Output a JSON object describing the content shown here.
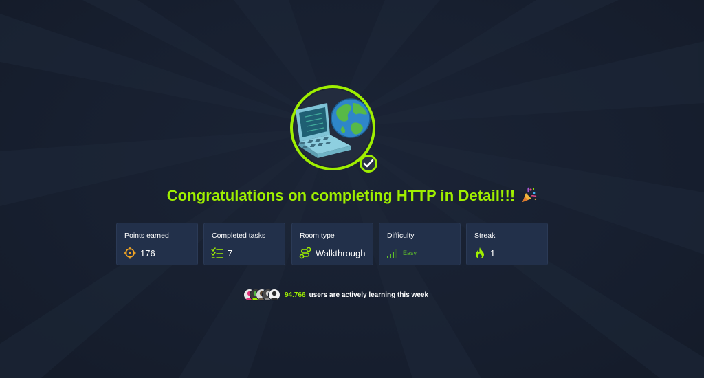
{
  "headline": {
    "text": "Congratulations on completing HTTP in Detail!!!",
    "emoji_icon": "party-popper-icon"
  },
  "badge": {
    "icon": "laptop-globe-badge-icon",
    "check_icon": "check-circle-icon",
    "ring_color": "#9fef00"
  },
  "stats": {
    "points": {
      "label": "Points earned",
      "value": "176",
      "icon": "target-icon"
    },
    "tasks": {
      "label": "Completed tasks",
      "value": "7",
      "icon": "checklist-icon"
    },
    "room_type": {
      "label": "Room type",
      "value": "Walkthrough",
      "icon": "route-icon"
    },
    "difficulty": {
      "label": "Difficulty",
      "value": "Easy",
      "icon": "signal-bars-icon"
    },
    "streak": {
      "label": "Streak",
      "value": "1",
      "icon": "flame-icon"
    }
  },
  "community": {
    "count": "94.766",
    "text": "users are actively learning this week"
  },
  "colors": {
    "accent": "#9fef00",
    "background": "#171f2f",
    "card": "#22304a",
    "easy": "#5fbf2a",
    "points_icon": "#f5a623"
  }
}
